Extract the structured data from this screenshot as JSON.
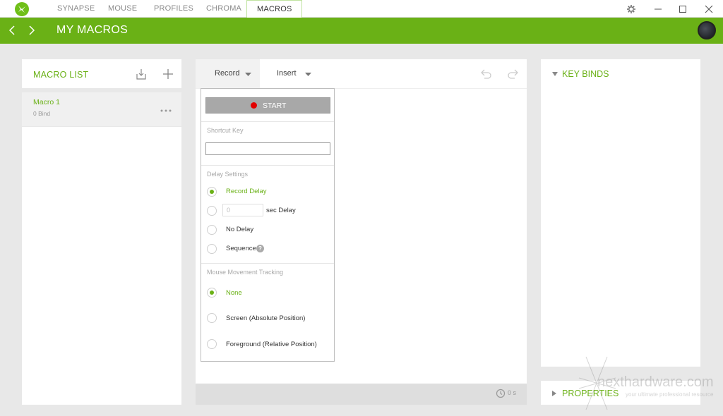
{
  "titlebar": {
    "tabs": [
      "SYNAPSE",
      "MOUSE",
      "PROFILES",
      "CHROMA",
      "MACROS"
    ],
    "active_tab": "MACROS"
  },
  "header": {
    "title": "MY MACROS"
  },
  "macro_list": {
    "title": "MACRO LIST",
    "items": [
      {
        "name": "Macro 1",
        "binds": "0 Bind"
      }
    ]
  },
  "editor": {
    "record_label": "Record",
    "insert_label": "Insert",
    "footer_time": "0 s",
    "dropdown": {
      "start_label": "START",
      "shortcut_key_label": "Shortcut Key",
      "shortcut_key_value": "",
      "delay_settings_label": "Delay Settings",
      "delay_options": [
        "Record Delay",
        "sec Delay",
        "No Delay",
        "Sequence"
      ],
      "delay_selected": "Record Delay",
      "sec_delay_placeholder": "0",
      "mouse_tracking_label": "Mouse Movement Tracking",
      "mouse_options": [
        "None",
        "Screen (Absolute Position)",
        "Foreground (Relative Position)"
      ],
      "mouse_selected": "None"
    }
  },
  "keybinds": {
    "title": "KEY BINDS"
  },
  "properties": {
    "title": "PROPERTIES"
  },
  "watermark": {
    "line1": "nexthardware.com",
    "line2": "your ultimate professional resource"
  },
  "colors": {
    "accent": "#6ab116",
    "record_dot": "#e20000"
  }
}
